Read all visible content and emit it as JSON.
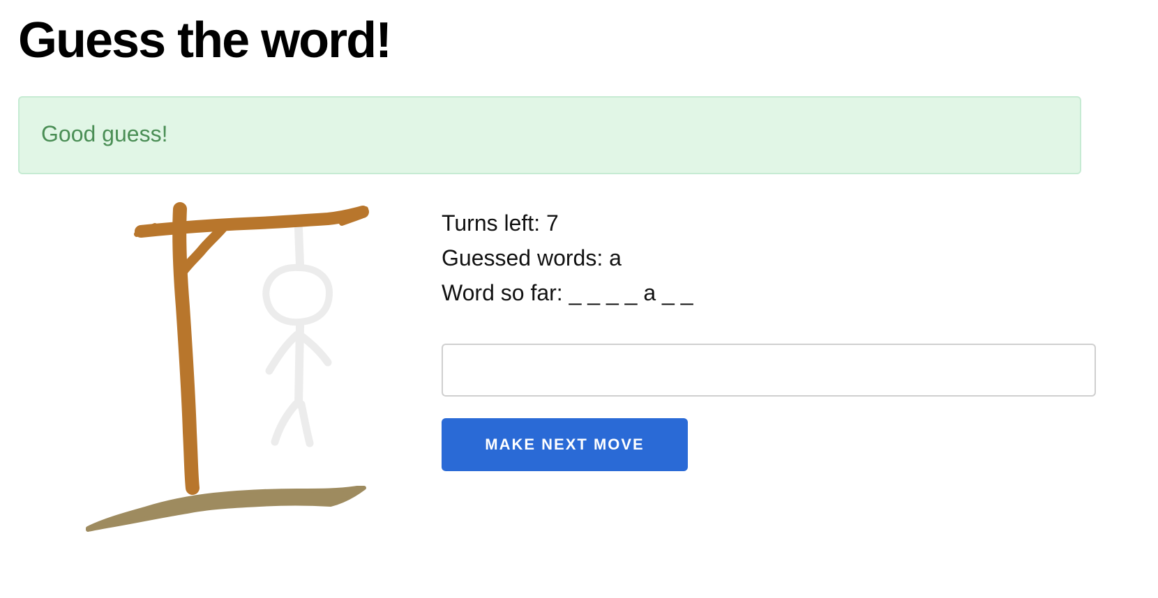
{
  "page": {
    "title": "Guess the word!"
  },
  "alert": {
    "message": "Good guess!",
    "background_color": "#e1f6e6",
    "text_color": "#4a8e55"
  },
  "game": {
    "turns_left_text": "Turns left: 7",
    "guessed_words_text": "Guessed words: a",
    "word_so_far_text": "Word so far: _ _ _ _ a _ _"
  },
  "form": {
    "guess_input_value": "",
    "submit_label": "MAKE NEXT MOVE",
    "button_color": "#2a6ad6"
  },
  "illustration": {
    "name": "hangman-gallows",
    "wood_color": "#b8762c",
    "ground_color": "#9e8b5f",
    "figure_color": "#ececec"
  }
}
